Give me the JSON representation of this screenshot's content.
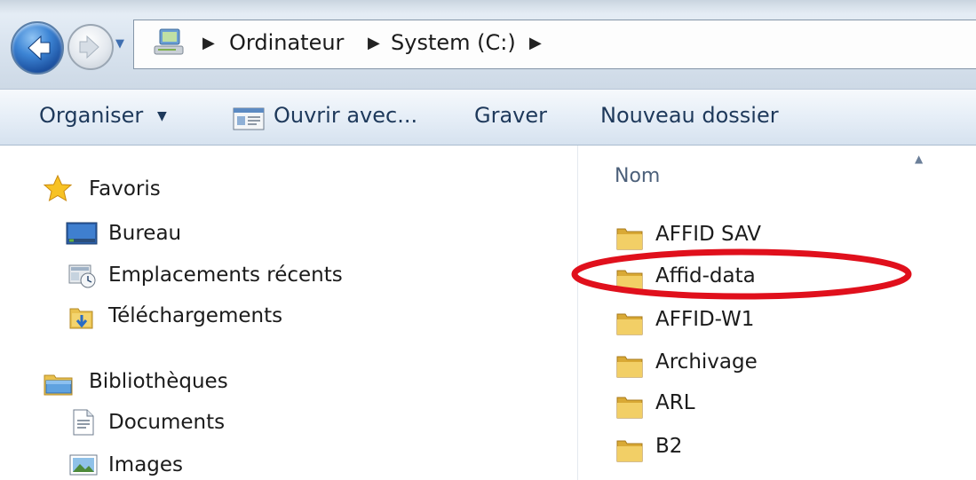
{
  "address_bar": {
    "breadcrumbs": [
      "Ordinateur",
      "System (C:)"
    ]
  },
  "toolbar": {
    "organise": "Organiser",
    "open_with": "Ouvrir avec...",
    "burn": "Graver",
    "new_folder": "Nouveau dossier"
  },
  "nav": {
    "favorites": {
      "label": "Favoris",
      "items": [
        "Bureau",
        "Emplacements récents",
        "Téléchargements"
      ]
    },
    "libraries": {
      "label": "Bibliothèques",
      "items": [
        "Documents",
        "Images"
      ]
    }
  },
  "content": {
    "column_name": "Nom",
    "folders": [
      "AFFID SAV",
      "Affid-data",
      "AFFID-W1",
      "Archivage",
      "ARL",
      "B2"
    ],
    "highlighted_folder": "Affid-data"
  },
  "colors": {
    "annotation": "#e0101c",
    "folder": "#e9c14e"
  }
}
